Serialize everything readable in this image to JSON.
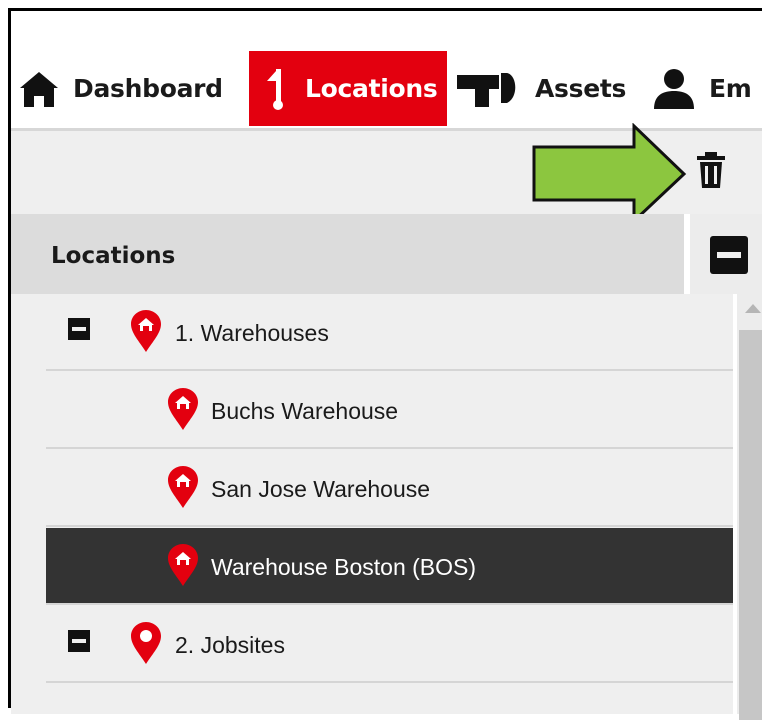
{
  "nav": {
    "items": [
      {
        "label": "Dashboard",
        "icon": "home-icon"
      },
      {
        "label": "Locations",
        "icon": "location-flag-icon",
        "active": true
      },
      {
        "label": "Assets",
        "icon": "hammer-drill-icon"
      },
      {
        "label": "Em",
        "icon": "employee-icon"
      }
    ]
  },
  "toolbar": {
    "delete_icon": "trash-icon",
    "annotation": "green-arrow-pointing-to-delete"
  },
  "locations_panel": {
    "title": "Locations",
    "collapse_icon": "minus-square-icon"
  },
  "tree": {
    "items": [
      {
        "label": "1. Warehouses",
        "level": 0,
        "expanded": true,
        "icon": "warehouse-pin-icon"
      },
      {
        "label": "Buchs Warehouse",
        "level": 1,
        "icon": "warehouse-pin-icon"
      },
      {
        "label": "San Jose Warehouse",
        "level": 1,
        "icon": "warehouse-pin-icon"
      },
      {
        "label": "Warehouse Boston (BOS)",
        "level": 1,
        "icon": "warehouse-pin-icon",
        "selected": true
      },
      {
        "label": "2. Jobsites",
        "level": 0,
        "expanded": true,
        "icon": "location-pin-icon"
      }
    ]
  },
  "colors": {
    "accent_red": "#e3000f",
    "arrow_green": "#8cc63f",
    "selected_row": "#333333"
  }
}
